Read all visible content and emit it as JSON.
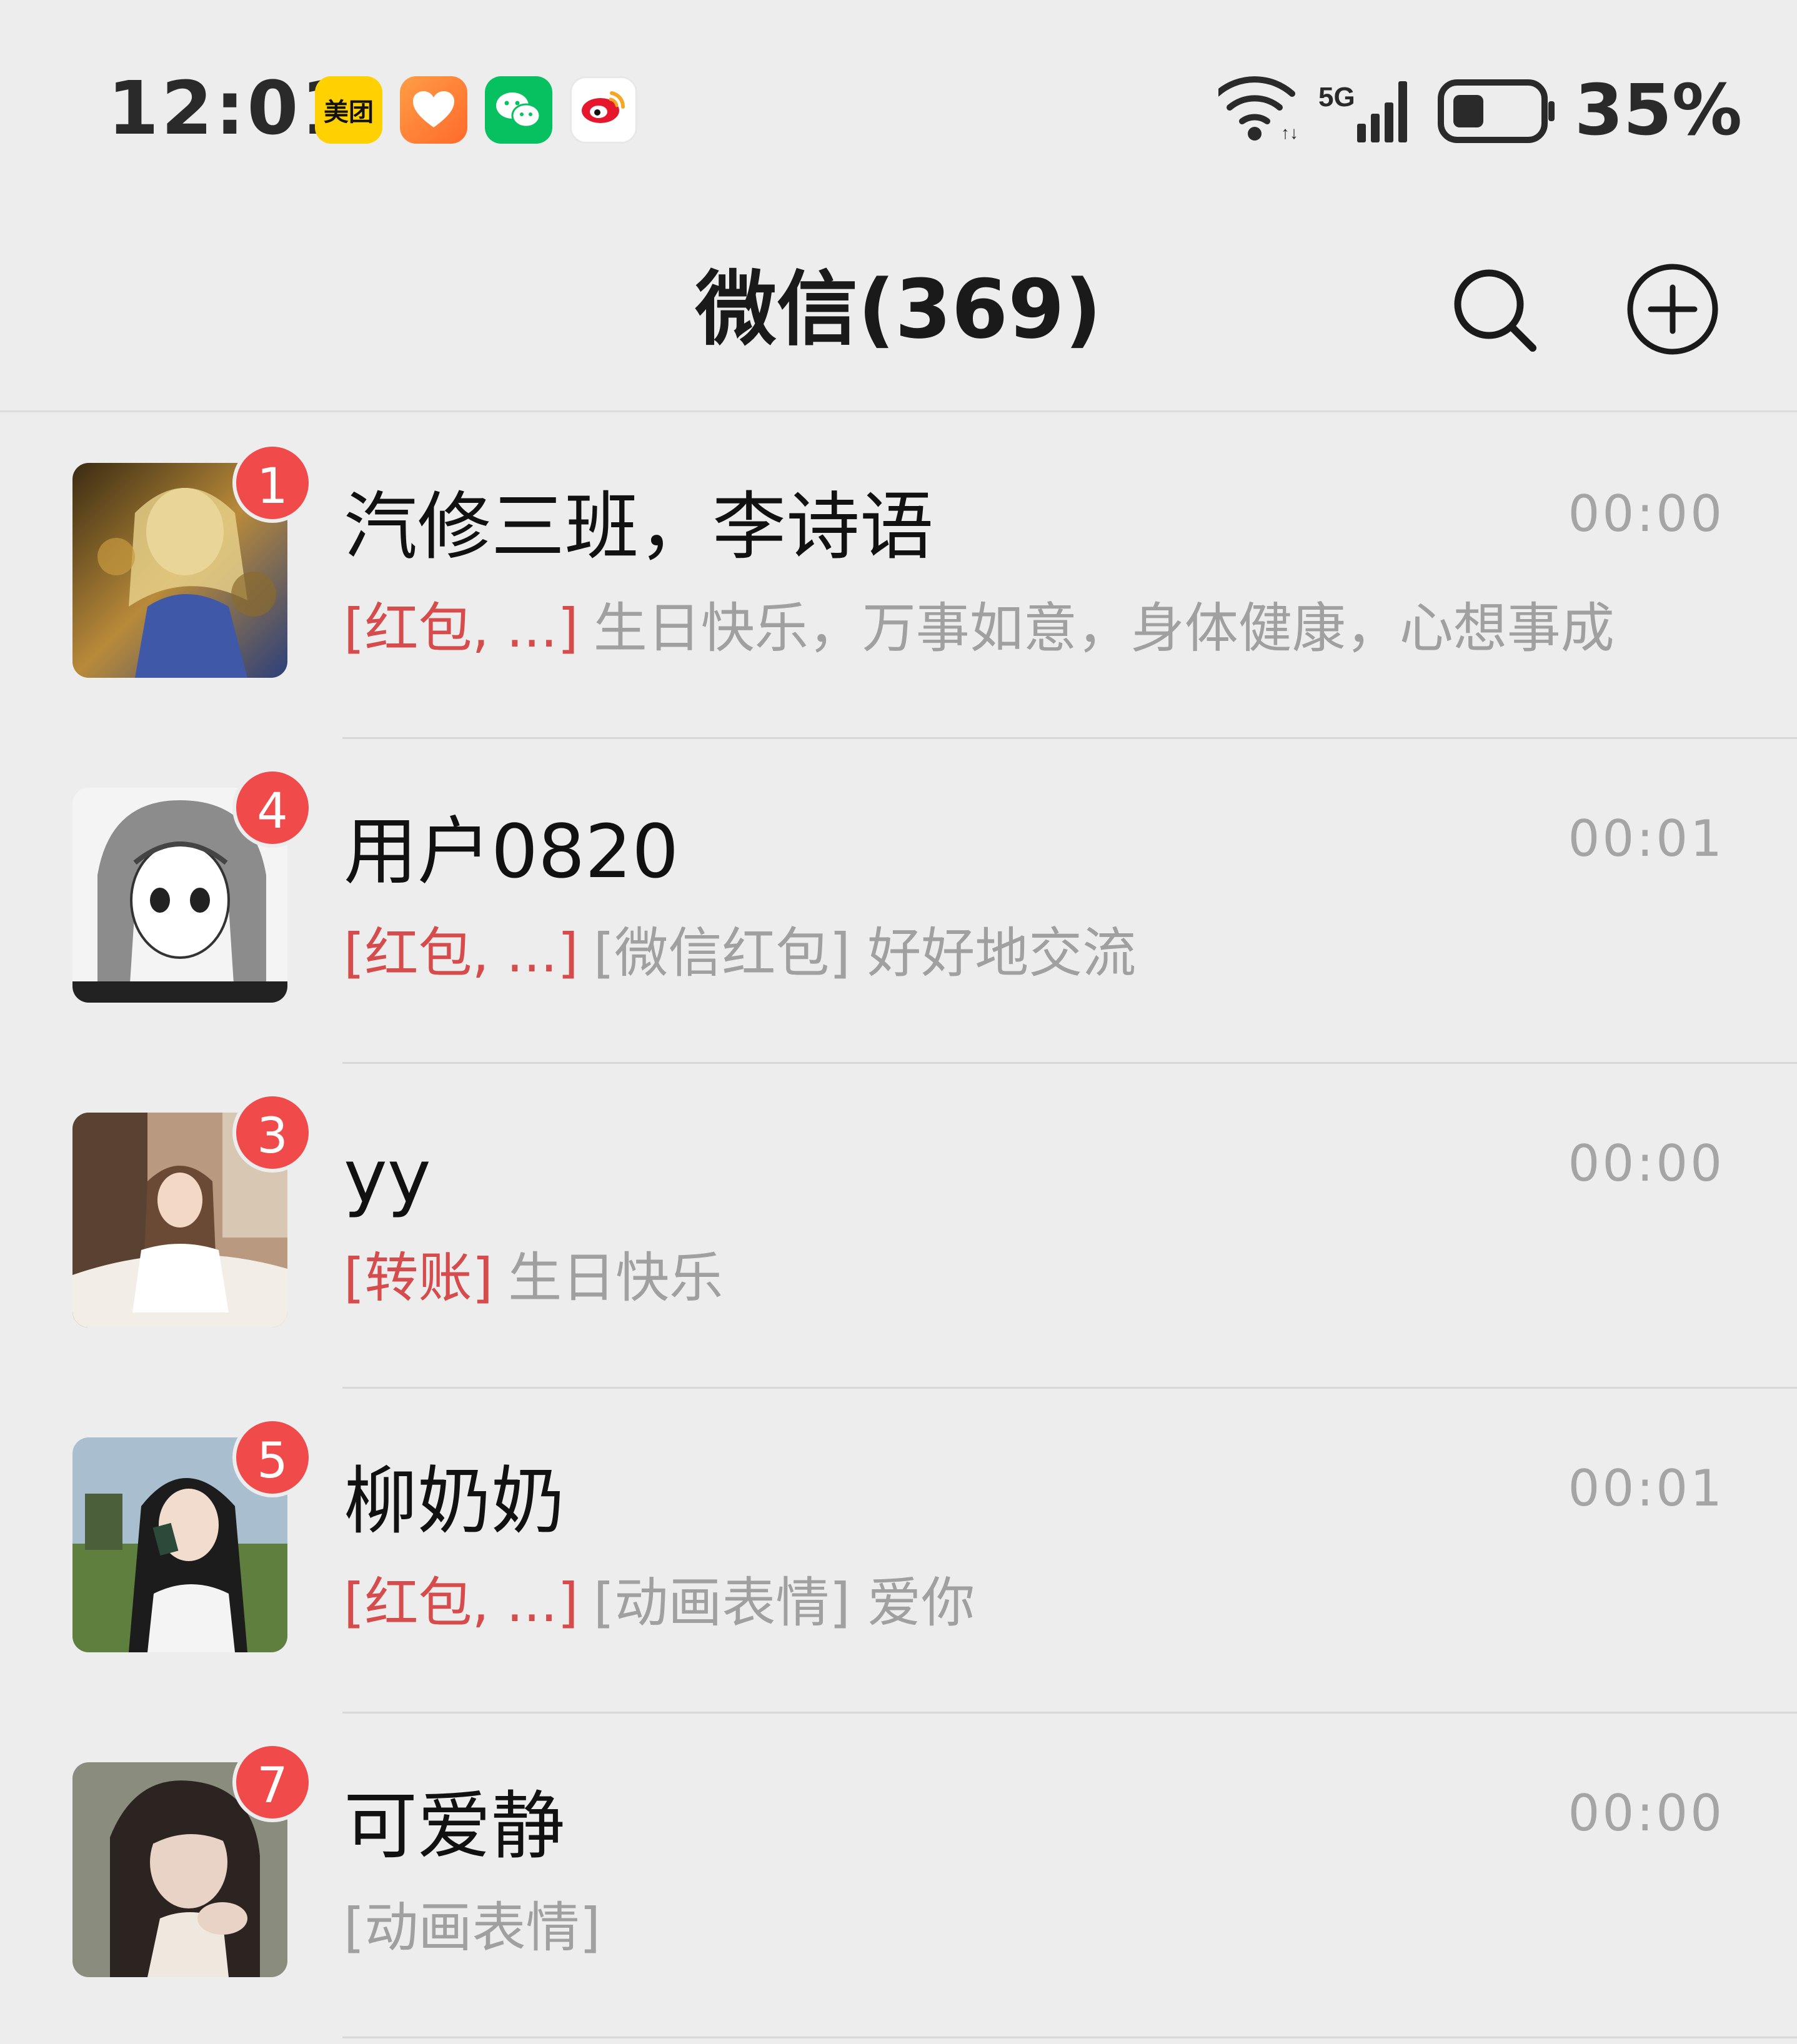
{
  "status_bar": {
    "time": "12:01",
    "network": "5G",
    "battery_percent": "35%",
    "battery_level": 0.35,
    "notification_apps": [
      {
        "name": "meituan-icon",
        "label": "美团"
      },
      {
        "name": "heart-app-icon"
      },
      {
        "name": "wechat-icon"
      },
      {
        "name": "weibo-icon"
      }
    ]
  },
  "header": {
    "title": "微信(369)",
    "search_icon": "search-icon",
    "add_icon": "plus-circle-icon"
  },
  "chats": [
    {
      "name": "汽修三班，李诗语",
      "time": "00:00",
      "unread": "1",
      "tag": "[红包, ...]",
      "preview": "生日快乐，万事如意，身体健康，心想事成"
    },
    {
      "name": "用户0820",
      "time": "00:01",
      "unread": "4",
      "tag": "[红包, ...]",
      "preview": "[微信红包] 好好地交流"
    },
    {
      "name": "yy",
      "time": "00:00",
      "unread": "3",
      "tag": "[转账]",
      "preview": "生日快乐"
    },
    {
      "name": "柳奶奶",
      "time": "00:01",
      "unread": "5",
      "tag": "[红包, ...]",
      "preview": "[动画表情] 爱你"
    },
    {
      "name": "可爱静",
      "time": "00:00",
      "unread": "7",
      "tag": "",
      "preview": "[动画表情]"
    }
  ],
  "colors": {
    "background": "#ededed",
    "badge": "#f04a4a",
    "tag_red": "#d64b4b",
    "wechat_green": "#07c160"
  }
}
